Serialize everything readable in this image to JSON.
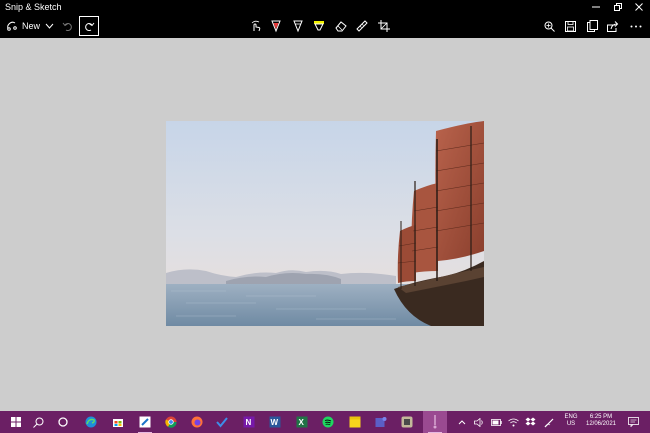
{
  "window": {
    "title": "Snip & Sketch",
    "controls": [
      "minimize-icon",
      "restore-icon",
      "close-icon"
    ]
  },
  "toolbar": {
    "new_label": "New",
    "left_icons": [
      "snip-icon",
      "chevron-down-icon",
      "undo-icon",
      "redo-icon"
    ],
    "tools": [
      "touch-writing-icon",
      "ballpoint-pen-icon",
      "pencil-icon",
      "highlighter-icon",
      "eraser-icon",
      "ruler-icon",
      "crop-icon"
    ],
    "right_icons": [
      "zoom-icon",
      "save-icon",
      "copy-icon",
      "share-icon",
      "more-icon"
    ],
    "active_tool": "ballpoint-pen-icon",
    "accent_color": "#d44bc7",
    "pen_color": "#e83a3a",
    "highlighter_color": "#f2f200"
  },
  "canvas": {
    "background": "#cdcdcd",
    "image": "sailing-junk-on-sea-photo"
  },
  "taskbar": {
    "background": "#6b1f64",
    "apps": [
      "start-icon",
      "search-icon",
      "cortana-icon",
      "edge-icon",
      "store-icon",
      "snip-sketch-icon",
      "chrome-icon",
      "firefox-icon",
      "todo-icon",
      "onenote-icon",
      "word-icon",
      "excel-icon",
      "spotify-icon",
      "sticky-notes-icon",
      "teams-icon",
      "media-icon",
      "active-app-icon"
    ],
    "tray": {
      "language": "ENG",
      "region": "US",
      "time": "6:25 PM",
      "date": "12/06/2021"
    }
  }
}
